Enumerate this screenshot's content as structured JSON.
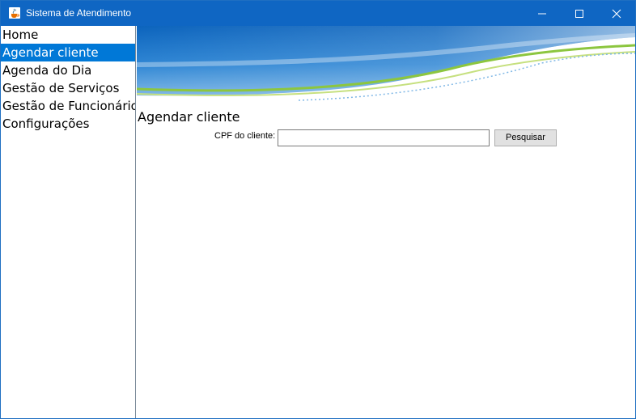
{
  "window": {
    "title": "Sistema de Atendimento",
    "app_icon": "java-coffee-icon",
    "controls": [
      "minimize-icon",
      "maximize-icon",
      "close-icon"
    ]
  },
  "sidebar": {
    "items": [
      {
        "label": "Home",
        "selected": false
      },
      {
        "label": "Agendar cliente",
        "selected": true
      },
      {
        "label": "Agenda do Dia",
        "selected": false
      },
      {
        "label": "Gestão de Serviços",
        "selected": false
      },
      {
        "label": "Gestão de Funcionários",
        "selected": false
      },
      {
        "label": "Configurações",
        "selected": false
      }
    ]
  },
  "main": {
    "title": "Agendar cliente",
    "cpf_label": "CPF do cliente:",
    "cpf_value": "",
    "search_button": "Pesquisar"
  },
  "colors": {
    "titlebar": "#0f66c3",
    "selection": "#0078d7",
    "banner_blue": "#1a73c8",
    "banner_green": "#8cc63f"
  }
}
